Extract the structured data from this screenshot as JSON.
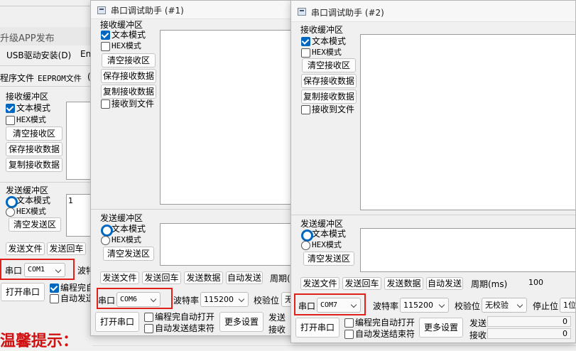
{
  "background": {
    "title_fragment": "升级APP发布",
    "menu_usb": "USB驱动安装(D)",
    "menu_en": "En",
    "menu_prog": "程序文件",
    "menu_eeprom": "EEPROM文件",
    "menu_cut": "(",
    "rx_group": "接收缓冲区",
    "rx_text_mode": "文本模式",
    "rx_hex_mode": "HEX模式",
    "clear_rx": "清空接收区",
    "save_rx": "保存接收数据",
    "copy_rx": "复制接收数据",
    "tx_group": "发送缓冲区",
    "tx_text_mode": "文本模式",
    "tx_hex_mode": "HEX模式",
    "clear_tx": "清空发送区",
    "tx_content": "1",
    "send_file": "发送文件",
    "send_enter": "发送回车",
    "port_label": "串口",
    "port_value": "COM1",
    "baud_fragment": "波特",
    "open_port": "打开串口",
    "auto_open_fragment": "编程完自",
    "auto_send_fragment": "自动发送",
    "tip": "温馨提示："
  },
  "window1": {
    "title": "串口调试助手 (#1)",
    "rx_group": "接收缓冲区",
    "rx_text_mode": "文本模式",
    "rx_hex_mode": "HEX模式",
    "clear_rx": "清空接收区",
    "save_rx": "保存接收数据",
    "copy_rx": "复制接收数据",
    "rx_to_file": "接收到文件",
    "tx_group": "发送缓冲区",
    "tx_text_mode": "文本模式",
    "tx_hex_mode": "HEX模式",
    "clear_tx": "清空发送区",
    "send_file": "发送文件",
    "send_enter": "发送回车",
    "send_data": "发送数据",
    "auto_send": "自动发送",
    "period_fragment": "周期(",
    "port_label": "串口",
    "port_value": "COM6",
    "baud_label": "波特率",
    "baud_value": "115200",
    "parity_label": "校验位",
    "parity_fragment": "无",
    "open_port": "打开串口",
    "auto_open": "编程完自动打开",
    "auto_close": "自动发送结束符",
    "more_settings": "更多设置",
    "send_count_label": "发送",
    "recv_count_label": "接收"
  },
  "window2": {
    "title": "串口调试助手 (#2)",
    "rx_group": "接收缓冲区",
    "rx_text_mode": "文本模式",
    "rx_hex_mode": "HEX模式",
    "clear_rx": "清空接收区",
    "save_rx": "保存接收数据",
    "copy_rx": "复制接收数据",
    "rx_to_file": "接收到文件",
    "tx_group": "发送缓冲区",
    "tx_text_mode": "文本模式",
    "tx_hex_mode": "HEX模式",
    "clear_tx": "清空发送区",
    "send_file": "发送文件",
    "send_enter": "发送回车",
    "send_data": "发送数据",
    "auto_send": "自动发送",
    "period_label": "周期(ms)",
    "period_value": "100",
    "port_label": "串口",
    "port_value": "COM7",
    "baud_label": "波特率",
    "baud_value": "115200",
    "parity_label": "校验位",
    "parity_value": "无校验",
    "stop_label": "停止位",
    "stop_fragment": "1位",
    "open_port": "打开串口",
    "auto_open": "编程完自动打开",
    "auto_close": "自动发送结束符",
    "more_settings": "更多设置",
    "send_count_label": "发送",
    "send_count": "0",
    "recv_count_label": "接收",
    "recv_count": "0"
  },
  "colors": {
    "highlight": "#e0201a",
    "tip_text": "#d01010",
    "accent": "#0067c0"
  }
}
